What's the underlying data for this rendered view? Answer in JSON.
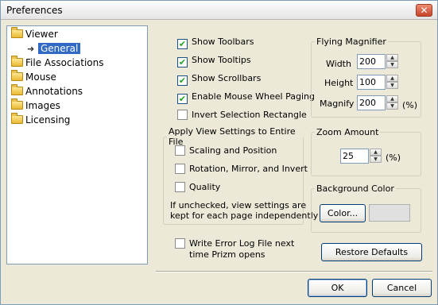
{
  "window": {
    "title": "Preferences",
    "close_glyph": "✕"
  },
  "tree": {
    "items": [
      {
        "label": "Viewer",
        "icon": "folder-icon"
      },
      {
        "label": "General",
        "icon": "arrow-right-icon",
        "selected": true
      },
      {
        "label": "File Associations",
        "icon": "folder-icon"
      },
      {
        "label": "Mouse",
        "icon": "folder-icon"
      },
      {
        "label": "Annotations",
        "icon": "folder-icon"
      },
      {
        "label": "Images",
        "icon": "folder-icon"
      },
      {
        "label": "Licensing",
        "icon": "folder-icon"
      }
    ]
  },
  "options": {
    "show_toolbars": {
      "label": "Show Toolbars",
      "checked": true
    },
    "show_tooltips": {
      "label": "Show Tooltips",
      "checked": true
    },
    "show_scrollbars": {
      "label": "Show Scrollbars",
      "checked": true
    },
    "wheel_paging": {
      "label": "Enable Mouse Wheel Paging",
      "checked": true
    },
    "invert_selection": {
      "label": "Invert Selection Rectangle",
      "checked": false
    }
  },
  "apply_view": {
    "legend": "Apply View Settings to Entire File",
    "scaling": {
      "label": "Scaling and Position",
      "checked": false
    },
    "rotation": {
      "label": "Rotation, Mirror, and Invert",
      "checked": false
    },
    "quality": {
      "label": "Quality",
      "checked": false
    },
    "note_line1": "If unchecked, view settings are",
    "note_line2": "kept for each page independently"
  },
  "error_log": {
    "line1": "Write Error Log File next",
    "line2": "time Prizm opens",
    "checked": false
  },
  "magnifier": {
    "legend": "Flying Magnifier",
    "width_label": "Width",
    "width_value": "200",
    "height_label": "Height",
    "height_value": "100",
    "magnify_label": "Magnify",
    "magnify_value": "200",
    "magnify_unit": "(%)"
  },
  "zoom": {
    "legend": "Zoom Amount",
    "value": "25",
    "unit": "(%)"
  },
  "background": {
    "legend": "Background Color",
    "button_label": "Color...",
    "swatch_color": "#e0e0e0"
  },
  "buttons": {
    "restore_defaults": "Restore Defaults",
    "ok": "OK",
    "cancel": "Cancel"
  },
  "check_glyph": "✔"
}
